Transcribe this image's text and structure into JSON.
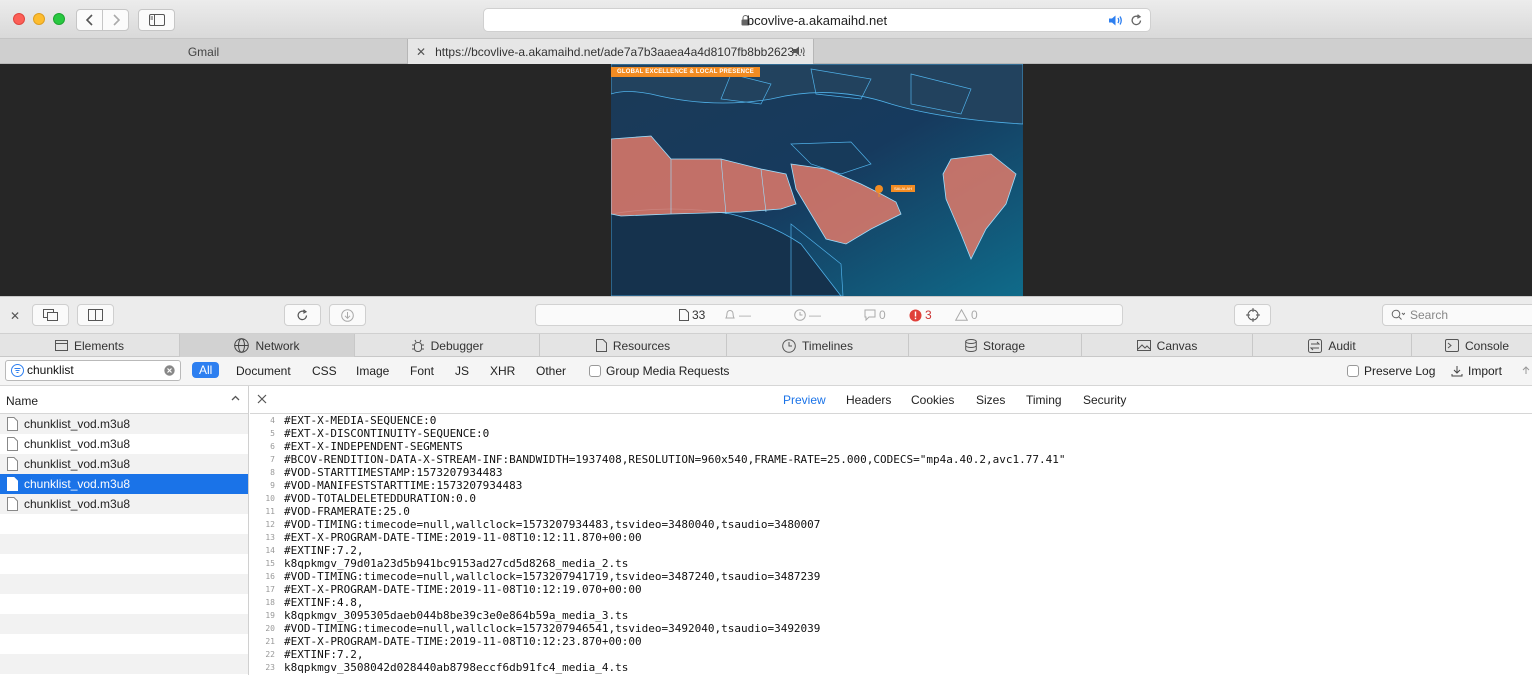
{
  "browser": {
    "address_host": "bcovlive-a.akamaihd.net",
    "tabs": [
      {
        "label": "Gmail"
      },
      {
        "label": "https://bcovlive-a.akamaihd.net/ade7a7b3aaea4a4d8107fb8bb2623…"
      }
    ]
  },
  "video": {
    "banner": "GLOBAL EXCELLENCE & LOCAL PRESENCE",
    "pin_label": "SALALAH"
  },
  "inspector": {
    "status": {
      "resources": "33",
      "load_time": "—",
      "timeline": "—",
      "logs": "0",
      "errors": "3",
      "warnings": "0"
    },
    "search_placeholder": "Search",
    "tabs": [
      "Elements",
      "Network",
      "Debugger",
      "Resources",
      "Timelines",
      "Storage",
      "Canvas",
      "Audit",
      "Console"
    ],
    "filter": {
      "value": "chunklist",
      "types": [
        "All",
        "Document",
        "CSS",
        "Image",
        "Font",
        "JS",
        "XHR",
        "Other"
      ],
      "group_media": "Group Media Requests",
      "preserve_log": "Preserve Log",
      "import": "Import"
    },
    "list": {
      "header": "Name",
      "items": [
        "chunklist_vod.m3u8",
        "chunklist_vod.m3u8",
        "chunklist_vod.m3u8",
        "chunklist_vod.m3u8",
        "chunklist_vod.m3u8"
      ],
      "selected_index": 3
    },
    "detail_tabs": [
      "Preview",
      "Headers",
      "Cookies",
      "Sizes",
      "Timing",
      "Security"
    ],
    "code_lines": [
      {
        "n": "4",
        "t": "#EXT-X-MEDIA-SEQUENCE:0"
      },
      {
        "n": "5",
        "t": "#EXT-X-DISCONTINUITY-SEQUENCE:0"
      },
      {
        "n": "6",
        "t": "#EXT-X-INDEPENDENT-SEGMENTS"
      },
      {
        "n": "7",
        "t": "#BCOV-RENDITION-DATA-X-STREAM-INF:BANDWIDTH=1937408,RESOLUTION=960x540,FRAME-RATE=25.000,CODECS=\"mp4a.40.2,avc1.77.41\""
      },
      {
        "n": "8",
        "t": "#VOD-STARTTIMESTAMP:1573207934483"
      },
      {
        "n": "9",
        "t": "#VOD-MANIFESTSTARTTIME:1573207934483"
      },
      {
        "n": "10",
        "t": "#VOD-TOTALDELETEDDURATION:0.0"
      },
      {
        "n": "11",
        "t": "#VOD-FRAMERATE:25.0"
      },
      {
        "n": "12",
        "t": "#VOD-TIMING:timecode=null,wallclock=1573207934483,tsvideo=3480040,tsaudio=3480007"
      },
      {
        "n": "13",
        "t": "#EXT-X-PROGRAM-DATE-TIME:2019-11-08T10:12:11.870+00:00"
      },
      {
        "n": "14",
        "t": "#EXTINF:7.2,"
      },
      {
        "n": "15",
        "t": "k8qpkmgv_79d01a23d5b941bc9153ad27cd5d8268_media_2.ts"
      },
      {
        "n": "16",
        "t": "#VOD-TIMING:timecode=null,wallclock=1573207941719,tsvideo=3487240,tsaudio=3487239"
      },
      {
        "n": "17",
        "t": "#EXT-X-PROGRAM-DATE-TIME:2019-11-08T10:12:19.070+00:00"
      },
      {
        "n": "18",
        "t": "#EXTINF:4.8,"
      },
      {
        "n": "19",
        "t": "k8qpkmgv_3095305daeb044b8be39c3e0e864b59a_media_3.ts"
      },
      {
        "n": "20",
        "t": "#VOD-TIMING:timecode=null,wallclock=1573207946541,tsvideo=3492040,tsaudio=3492039"
      },
      {
        "n": "21",
        "t": "#EXT-X-PROGRAM-DATE-TIME:2019-11-08T10:12:23.870+00:00"
      },
      {
        "n": "22",
        "t": "#EXTINF:7.2,"
      },
      {
        "n": "23",
        "t": "k8qpkmgv_3508042d028440ab8798eccf6db91fc4_media_4.ts"
      }
    ]
  }
}
